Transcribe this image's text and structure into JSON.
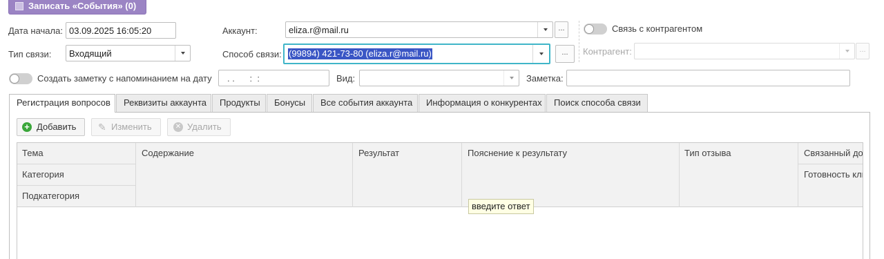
{
  "top_button": {
    "label": "Записать «События» (0)"
  },
  "row1": {
    "start_date_label": "Дата начала:",
    "start_date_value": "03.09.2025 16:05:20",
    "account_label": "Аккаунт:",
    "account_value": "eliza.r@mail.ru",
    "link_toggle_label": "Связь с контрагентом"
  },
  "row2": {
    "conn_type_label": "Тип связи:",
    "conn_type_value": "Входящий",
    "method_label": "Способ связи:",
    "method_value": "(99894) 421-73-80 (eliza.r@mail.ru)",
    "counterparty_label": "Контрагент:",
    "counterparty_value": ""
  },
  "row3": {
    "note_toggle_label": "Создать заметку с напоминанием на дату",
    "date_placeholder": ". .      :  :",
    "view_label": "Вид:",
    "view_value": "",
    "note_label": "Заметка:",
    "note_value": ""
  },
  "more_glyph": "...",
  "tabs": [
    {
      "label": "Регистрация вопросов",
      "active": true
    },
    {
      "label": "Реквизиты аккаунта"
    },
    {
      "label": "Продукты"
    },
    {
      "label": "Бонусы"
    },
    {
      "label": "Все события аккаунта"
    },
    {
      "label": "Информация о конкурентах"
    },
    {
      "label": "Поиск способа связи"
    }
  ],
  "toolbar": {
    "add_label": "Добавить",
    "edit_label": "Изменить",
    "delete_label": "Удалить"
  },
  "table": {
    "col_topic": "Тема",
    "col_category": "Категория",
    "col_subcategory": "Подкатегория",
    "col_content": "Содержание",
    "col_result": "Результат",
    "col_explanation": "Пояснение к результату",
    "col_feedback_type": "Тип отзыва",
    "col_related": "Связанный до",
    "col_readiness": "Готовность кли"
  },
  "tooltip": {
    "text": "введите ответ"
  },
  "colors": {
    "accent_purple": "#9b84c4",
    "focus_border": "#3fb5c8",
    "selection": "#3a56c5",
    "add_green": "#3aa63a"
  }
}
